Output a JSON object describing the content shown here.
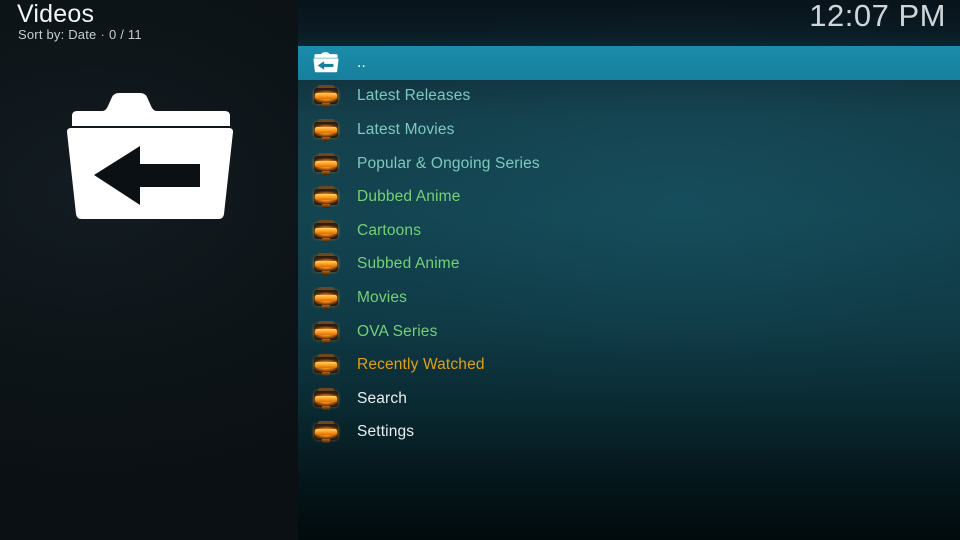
{
  "header": {
    "title": "Videos",
    "sort_label": "Sort by: Date",
    "separator": "·",
    "count": "0 / 11",
    "clock": "12:07 PM"
  },
  "preview": {
    "icon": "folder-back-icon"
  },
  "colors": {
    "selection_teal": "#1a89a8",
    "panel_dark": "#0d1418",
    "text_mint": "#79c6bb",
    "text_green": "#77d47a",
    "text_amber": "#e5a216",
    "text_white": "#e9eef0"
  },
  "list": {
    "items": [
      {
        "label": "..",
        "icon": "folder-back-icon",
        "color": "#ffffff",
        "selected": true
      },
      {
        "label": "Latest Releases",
        "icon": "addon-badge-icon",
        "color": "#7ec9bd",
        "selected": false
      },
      {
        "label": "Latest Movies",
        "icon": "addon-badge-icon",
        "color": "#7ec9bd",
        "selected": false
      },
      {
        "label": "Popular & Ongoing Series",
        "icon": "addon-badge-icon",
        "color": "#7ec9bd",
        "selected": false
      },
      {
        "label": "Dubbed Anime",
        "icon": "addon-badge-icon",
        "color": "#74d176",
        "selected": false
      },
      {
        "label": "Cartoons",
        "icon": "addon-badge-icon",
        "color": "#74d176",
        "selected": false
      },
      {
        "label": "Subbed Anime",
        "icon": "addon-badge-icon",
        "color": "#74d176",
        "selected": false
      },
      {
        "label": "Movies",
        "icon": "addon-badge-icon",
        "color": "#74d176",
        "selected": false
      },
      {
        "label": "OVA Series",
        "icon": "addon-badge-icon",
        "color": "#74d176",
        "selected": false
      },
      {
        "label": "Recently Watched",
        "icon": "addon-badge-icon",
        "color": "#e0a015",
        "selected": false
      },
      {
        "label": "Search",
        "icon": "addon-badge-icon",
        "color": "#e9eef0",
        "selected": false
      },
      {
        "label": "Settings",
        "icon": "addon-badge-icon",
        "color": "#e9eef0",
        "selected": false
      }
    ]
  }
}
